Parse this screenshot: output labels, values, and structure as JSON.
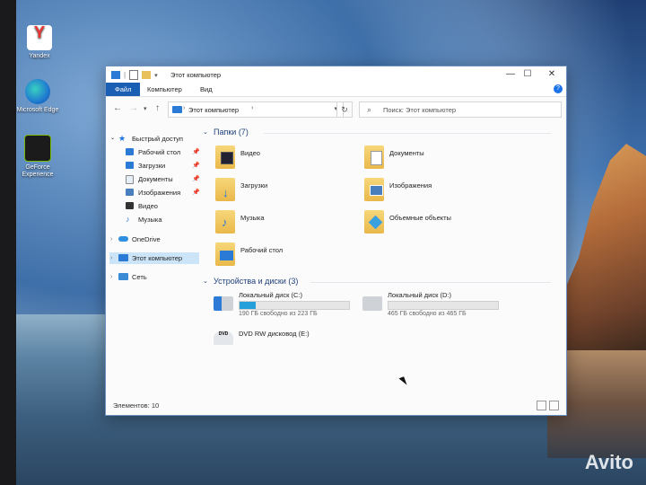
{
  "desktop": {
    "icons": [
      {
        "label": "Yandex",
        "icon": "yandex-icon",
        "color": "#ffffff"
      },
      {
        "label": "Microsoft Edge",
        "icon": "edge-icon",
        "color": "#1f7ad1"
      },
      {
        "label": "GeForce Experience",
        "icon": "geforce-icon",
        "color": "#76b900"
      }
    ],
    "watermark": "Avito"
  },
  "window": {
    "title": "Этот компьютер",
    "ribbon_tabs": [
      "Файл",
      "Компьютер",
      "Вид"
    ],
    "address": "Этот компьютер",
    "search_placeholder": "Поиск: Этот компьютер",
    "controls": {
      "minimize": "—",
      "maximize": "☐",
      "close": "✕",
      "help": "?"
    }
  },
  "nav": {
    "quick_access": "Быстрый доступ",
    "quick_items": [
      "Рабочий стол",
      "Загрузки",
      "Документы",
      "Изображения",
      "Видео",
      "Музыка"
    ],
    "onedrive": "OneDrive",
    "this_pc": "Этот компьютер",
    "network": "Сеть"
  },
  "content": {
    "folders_header": "Папки (7)",
    "folders": [
      "Видео",
      "Документы",
      "Загрузки",
      "Изображения",
      "Музыка",
      "Объемные объекты",
      "Рабочий стол"
    ],
    "devices_header": "Устройства и диски (3)",
    "drives": [
      {
        "name": "Локальный диск (C:)",
        "status": "190 ГБ свободно из 223 ГБ",
        "used_fraction": 0.15
      },
      {
        "name": "Локальный диск (D:)",
        "status": "465 ГБ свободно из 465 ГБ",
        "used_fraction": 0.0
      }
    ],
    "dvd": "DVD RW дисковод (E:)"
  },
  "status_bar": "Элементов: 10",
  "colors": {
    "accent": "#1a5fb4",
    "drive_fill": "#26a0da",
    "section": "#1e3f7a",
    "folder": "#e9b84a"
  }
}
